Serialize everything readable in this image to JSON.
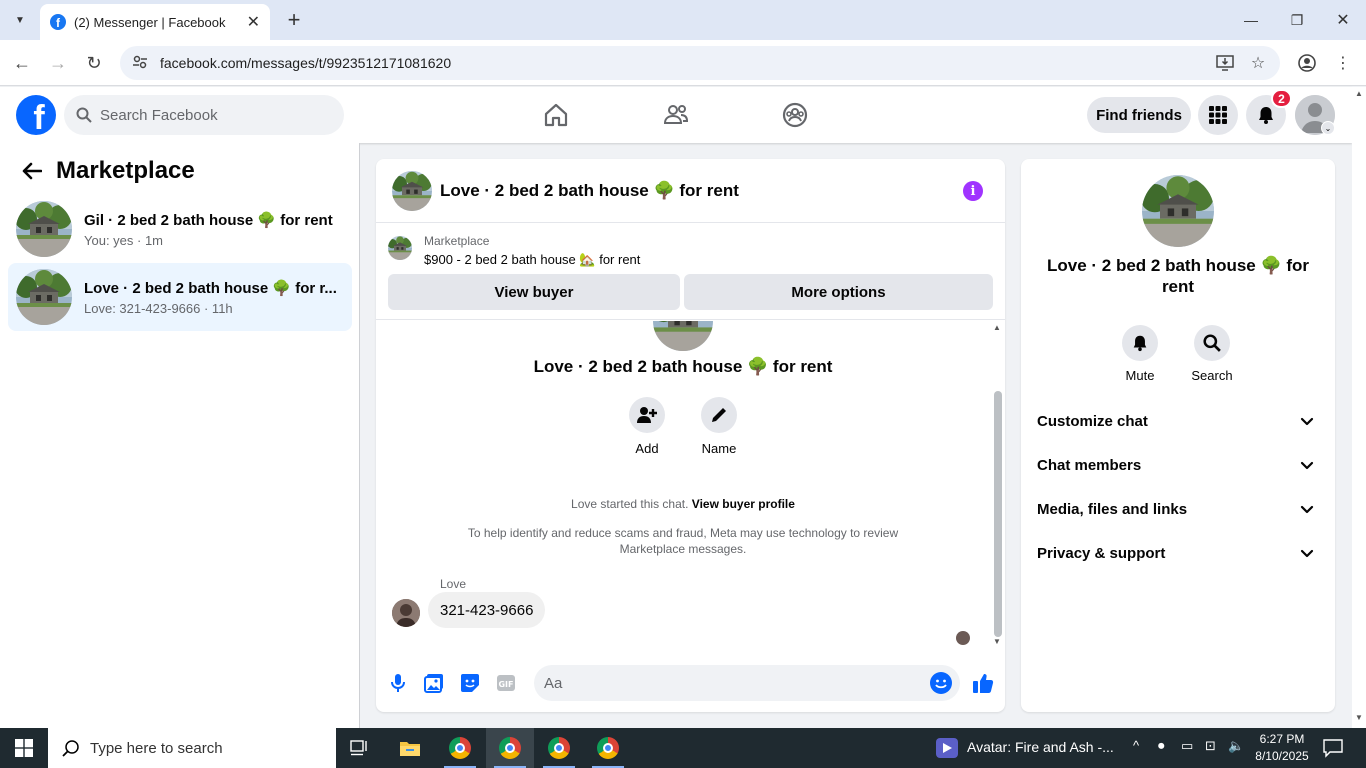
{
  "browser": {
    "tab_title": "(2) Messenger | Facebook",
    "url": "facebook.com/messages/t/9923512171081620"
  },
  "fb": {
    "search_placeholder": "Search Facebook",
    "find_friends": "Find friends",
    "notification_count": "2"
  },
  "sidebar": {
    "title": "Marketplace",
    "conversations": [
      {
        "name": "Gil · 2 bed 2 bath house 🌳 for rent",
        "sub": "You: yes · 1m",
        "active": false
      },
      {
        "name": "Love · 2 bed 2 bath house 🌳 for r...",
        "sub": "Love: 321-423-9666 · 11h",
        "active": true
      }
    ]
  },
  "chat": {
    "title": "Love · 2 bed 2 bath house 🌳 for rent",
    "marketplace_label": "Marketplace",
    "listing": "$900 - 2 bed 2 bath house 🏡 for rent",
    "view_buyer": "View buyer",
    "more_options": "More options",
    "conversation_title": "Love · 2 bed 2 bath house 🌳 for rent",
    "actions": {
      "add": "Add",
      "name": "Name"
    },
    "started_text": "Love started this chat.",
    "view_buyer_profile": "View buyer profile",
    "disclaimer": "To help identify and reduce scams and fraud, Meta may use technology to review Marketplace messages.",
    "sender": "Love",
    "message": "321-423-9666",
    "composer_placeholder": "Aa"
  },
  "info_panel": {
    "title": "Love · 2 bed 2 bath house 🌳 for rent",
    "mute": "Mute",
    "search": "Search",
    "sections": [
      "Customize chat",
      "Chat members",
      "Media, files and links",
      "Privacy & support"
    ]
  },
  "taskbar": {
    "search_placeholder": "Type here to search",
    "media_title": "Avatar: Fire and Ash -...",
    "time": "6:27 PM",
    "date": "8/10/2025"
  },
  "colors": {
    "fb_blue": "#0866ff",
    "active_conv": "#ebf5ff",
    "info_purple": "#a033ff",
    "badge_red": "#e41e3f"
  }
}
